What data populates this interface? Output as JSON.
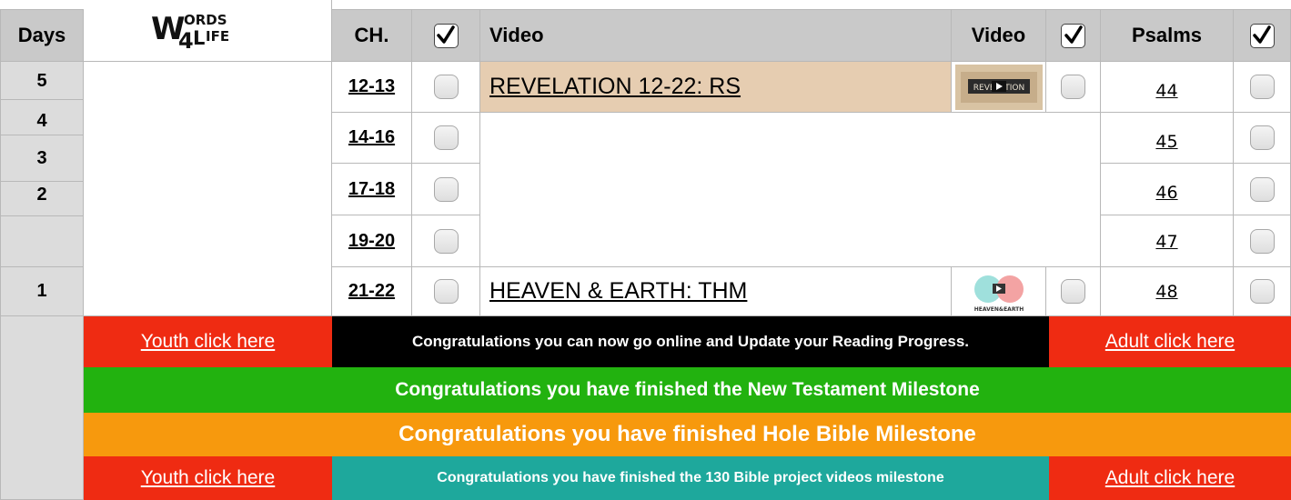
{
  "header": {
    "days": "Days",
    "logo": "WORDS 4 LIFE",
    "ch": "CH.",
    "video": "Video",
    "video2": "Video",
    "psalms": "Psalms"
  },
  "rows": [
    {
      "day": "5",
      "ch": "12-13",
      "video": "REVELATION 12-22: RS",
      "thumb": "REVELATION",
      "psalm": "44"
    },
    {
      "day": "4",
      "ch": "14-16",
      "psalm": "45"
    },
    {
      "day": "3",
      "ch": "17-18",
      "psalm": "46"
    },
    {
      "day": "2",
      "ch": "19-20",
      "psalm": "47"
    },
    {
      "day": "1",
      "ch": "21-22",
      "video": "HEAVEN & EARTH: THM",
      "thumb": "HEAVEN&EARTH",
      "psalm": "48"
    }
  ],
  "banners": {
    "youth1": "Youth click here",
    "update": "Congratulations you can now go online and Update your Reading Progress.",
    "adult1": "Adult click here",
    "nt": "Congratulations you have finished the New Testament Milestone",
    "bible": "Congratulations you have finished Hole Bible Milestone",
    "youth2": "Youth click here",
    "videos": "Congratulations you have finished the 130 Bible project videos milestone",
    "adult2": "Adult click here"
  },
  "colors": {
    "header_gray": "#c9c9c9",
    "red": "#ef2b12",
    "black": "#000000",
    "green": "#22b20f",
    "orange": "#f7990d",
    "teal": "#1ea89c",
    "video_highlight": "#e6cdb1"
  }
}
